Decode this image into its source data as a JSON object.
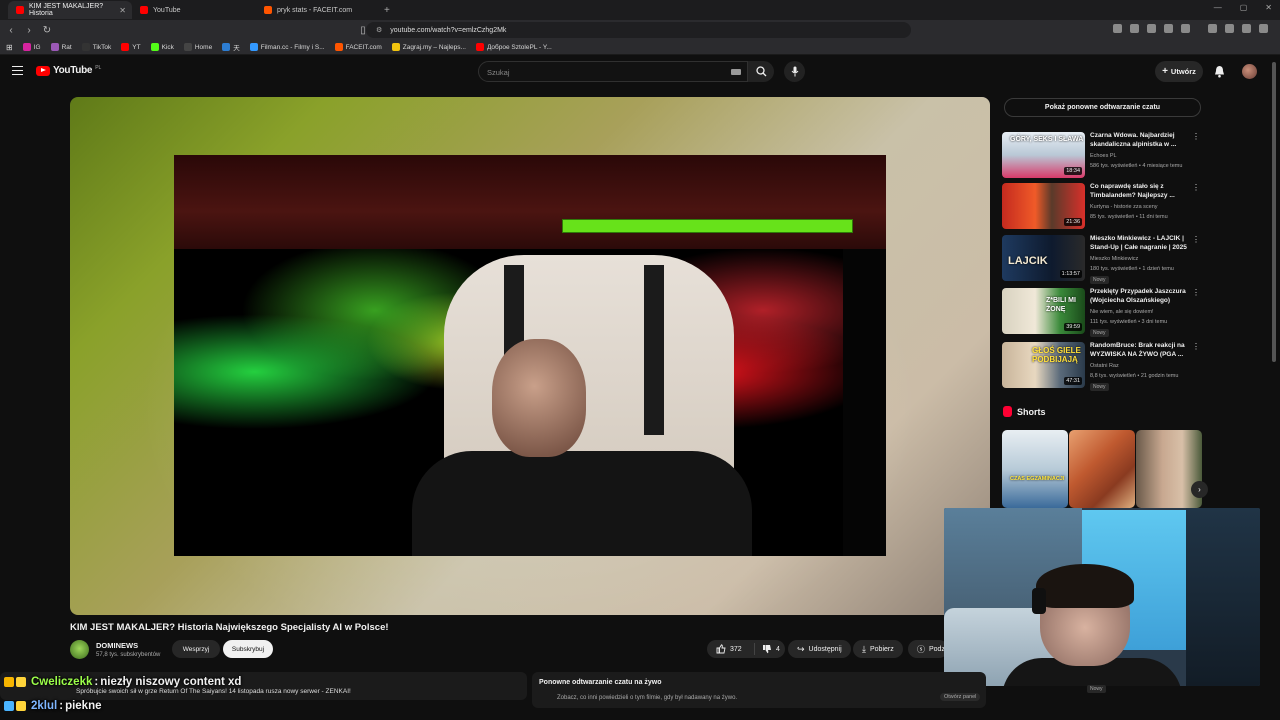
{
  "browser": {
    "tabs": [
      {
        "label": "KIM JEST MAKALJER? Historia",
        "color": "#ff0000",
        "active": true
      },
      {
        "label": "YouTube",
        "color": "#ff0000",
        "active": false
      },
      {
        "label": "pryk stats - FACEIT.com",
        "color": "#ff5500",
        "active": false
      }
    ],
    "url": "youtube.com/watch?v=emlzCzhg2Mk",
    "bookmarks": [
      {
        "label": "IG",
        "color": "#d6249f"
      },
      {
        "label": "Rat",
        "color": "#9b59b6"
      },
      {
        "label": "TikTok",
        "color": "#333333"
      },
      {
        "label": "YT",
        "color": "#ff0000"
      },
      {
        "label": "Kick",
        "color": "#53fc18"
      },
      {
        "label": "Home",
        "color": "#444444"
      },
      {
        "label": "天",
        "color": "#2d7dd2"
      },
      {
        "label": "Filman.cc - Filmy i S...",
        "color": "#3399ff"
      },
      {
        "label": "FACEIT.com",
        "color": "#ff5500"
      },
      {
        "label": "Zagraj.my – Najleps...",
        "color": "#f1c40f"
      },
      {
        "label": "Доброе SztolePL - Y...",
        "color": "#ff0000"
      }
    ]
  },
  "header": {
    "logo": "YouTube",
    "logo_region": "PL",
    "search_placeholder": "Szukaj",
    "create_label": "Utwórz"
  },
  "video": {
    "title": "KIM JEST MAKALJER? Historia Największego Specjalisty AI w Polsce!",
    "channel": "DOMINEWS",
    "subscribers": "57,8 tys. subskrybentów",
    "support_label": "Wesprzyj",
    "subscribe_label": "Subskrybuj",
    "likes": "372",
    "dislikes": "4",
    "share_label": "Udostępnij",
    "download_label": "Pobierz",
    "clip_label": "Podzi"
  },
  "sidebar": {
    "chat_replay_button": "Pokaż ponowne odtwarzanie czatu",
    "recommendations": [
      {
        "title": "Czarna Wdowa. Najbardziej skandaliczna alpinistka w ...",
        "channel": "Echoes PL",
        "meta": "586 tys. wyświetleń • 4 miesiące temu",
        "duration": "18:34",
        "thumb_text": "GÓRY, SEKS I SŁAWA",
        "badge": ""
      },
      {
        "title": "Co naprawdę stało się z Timbalandem? Najlepszy ...",
        "channel": "Kurtyna - historie zza sceny",
        "meta": "85 tys. wyświetleń • 11 dni temu",
        "duration": "21:36",
        "thumb_text": "",
        "badge": ""
      },
      {
        "title": "Mieszko Minkiewicz - LAJCIK | Stand-Up | Całe nagranie | 2025",
        "channel": "Mieszko Minkiewicz",
        "meta": "180 tys. wyświetleń • 1 dzień temu",
        "duration": "1:13:57",
        "thumb_text": "LAJCIK",
        "badge": "Nowy"
      },
      {
        "title": "Przeklęty Przypadek Jaszczura (Wojciecha Olszańskiego)",
        "channel": "Nie wiem, ale się dowiem!",
        "meta": "111 tys. wyświetleń • 3 dni temu",
        "duration": "39:59",
        "thumb_text": "Z*BILI MI ŻONĘ",
        "badge": "Nowy"
      },
      {
        "title": "RandomBruce: Brak reakcji na WYZWISKA NA ŻYWO (PGA ...",
        "channel": "Ostatni Raz",
        "meta": "8,8 tys. wyświetleń • 21 godzin temu",
        "duration": "47:31",
        "thumb_text": "GŁOŚ GIELE PODBIJAJĄ",
        "badge": "Nowy"
      }
    ],
    "shorts_title": "Shorts",
    "shorts": [
      {
        "caption": "CZAS EGZAMINACJI"
      },
      {
        "caption": ""
      },
      {
        "caption": ""
      }
    ],
    "tail_badge": "Nowy"
  },
  "bottom": {
    "promo_text": "Spróbujcie swoich sił w grze Return Of The Saiyans! 14 listopada rusza nowy serwer - ZENKAI!",
    "replay_title": "Ponowne odtwarzanie czatu na żywo",
    "replay_sub": "Zobacz, co inni powiedzieli o tym filmie, gdy był nadawany na żywo.",
    "replay_button": "Otwórz panel"
  },
  "stream_chat": [
    {
      "user": "Cweliczekk",
      "message": "niezły niszowy content xd",
      "user_color": "#9cff4a"
    },
    {
      "user": "2klul",
      "message": "piekne",
      "user_color": "#7fb6ff"
    }
  ]
}
